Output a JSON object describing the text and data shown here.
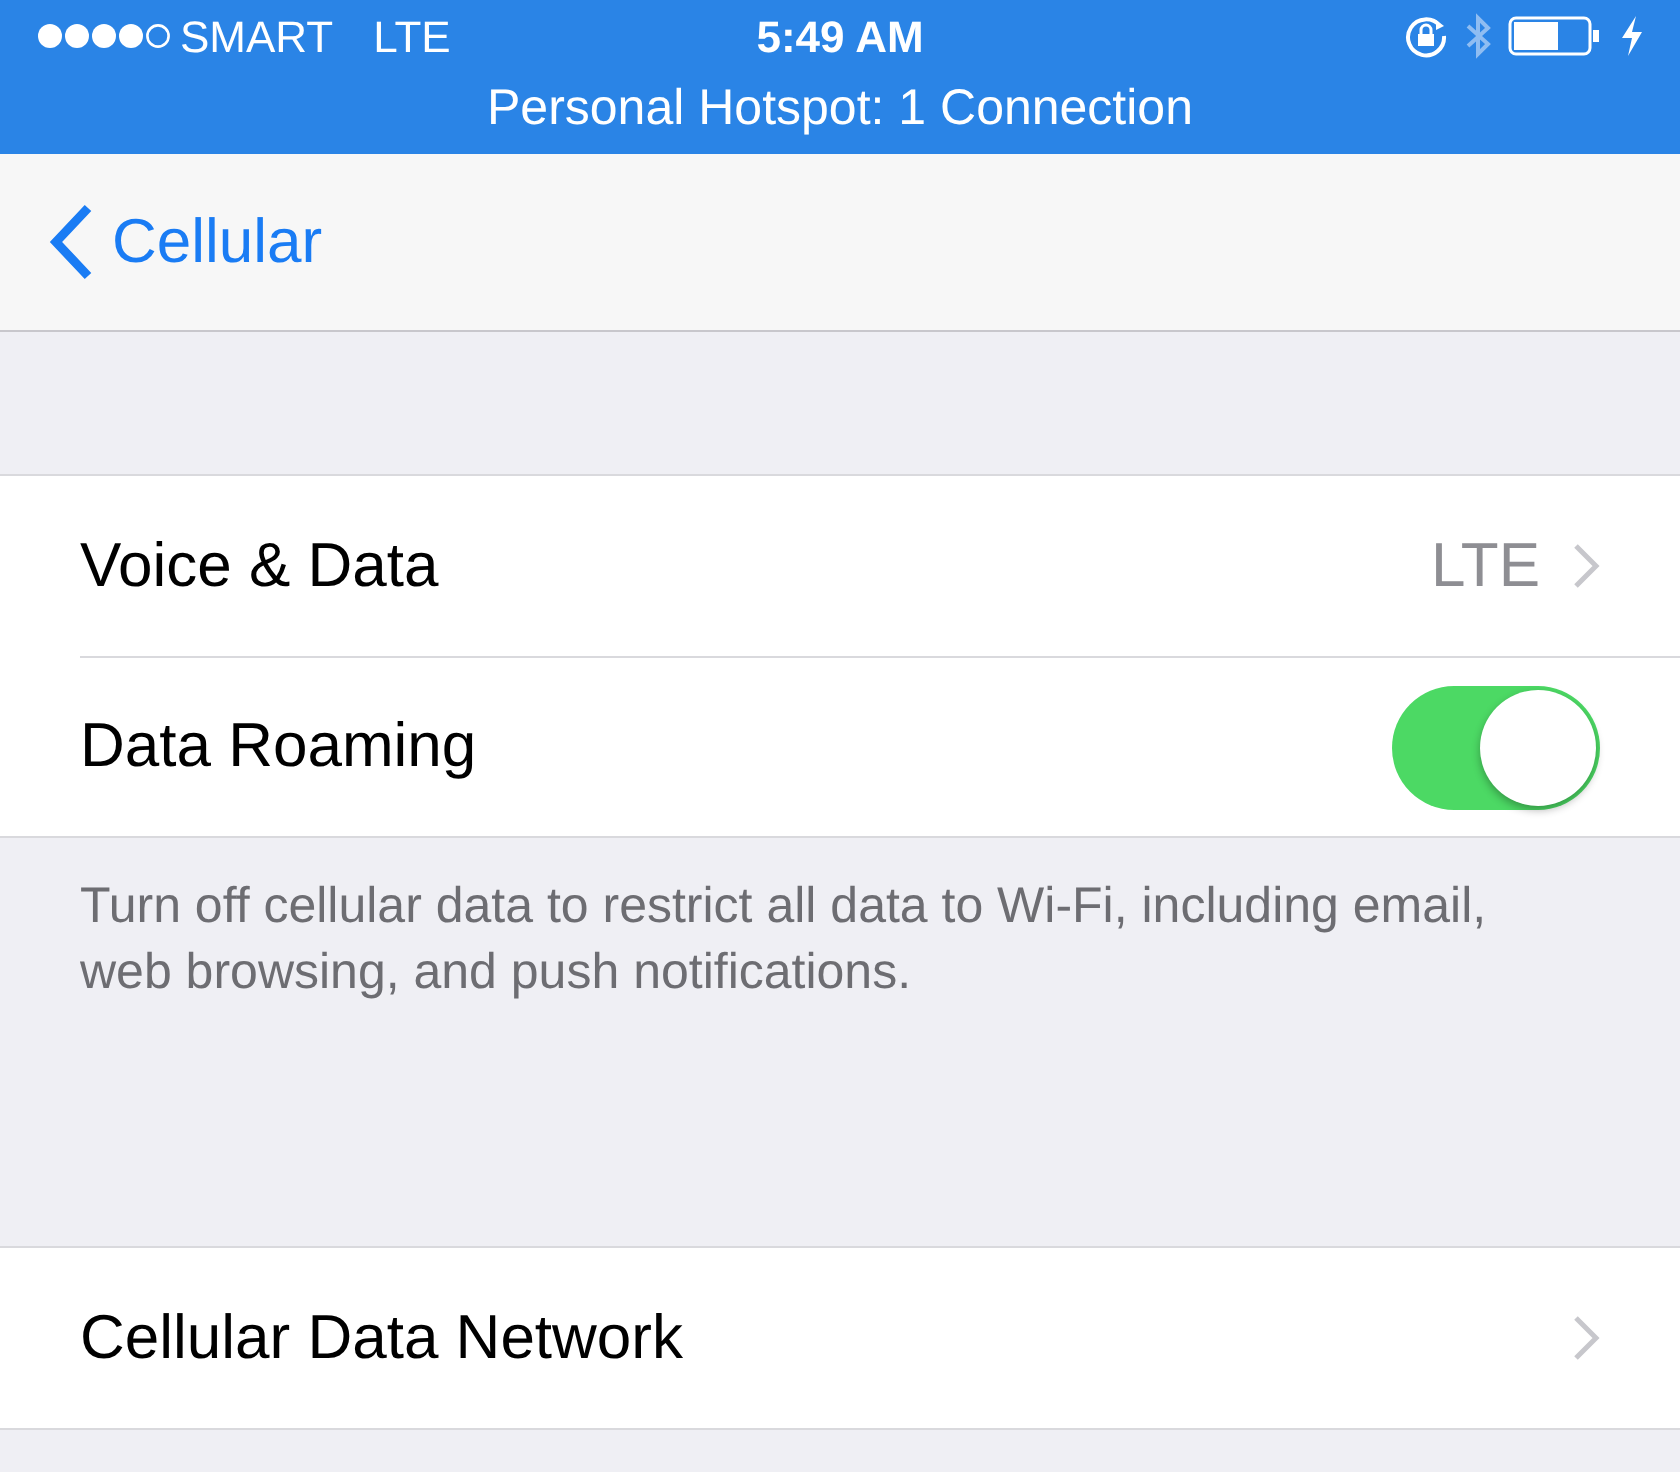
{
  "status_bar": {
    "carrier": "SMART",
    "network": "LTE",
    "time": "5:49 AM",
    "banner": "Personal Hotspot: 1 Connection"
  },
  "nav": {
    "back": "Cellular"
  },
  "groups": [
    {
      "rows": [
        {
          "kind": "disclosure",
          "label": "Voice & Data",
          "detail": "LTE"
        },
        {
          "kind": "toggle",
          "label": "Data Roaming",
          "on": true
        }
      ],
      "footer": "Turn off cellular data to restrict all data to Wi-Fi, including email, web browsing, and push notifications."
    },
    {
      "rows": [
        {
          "kind": "disclosure",
          "label": "Cellular Data Network"
        }
      ]
    }
  ]
}
